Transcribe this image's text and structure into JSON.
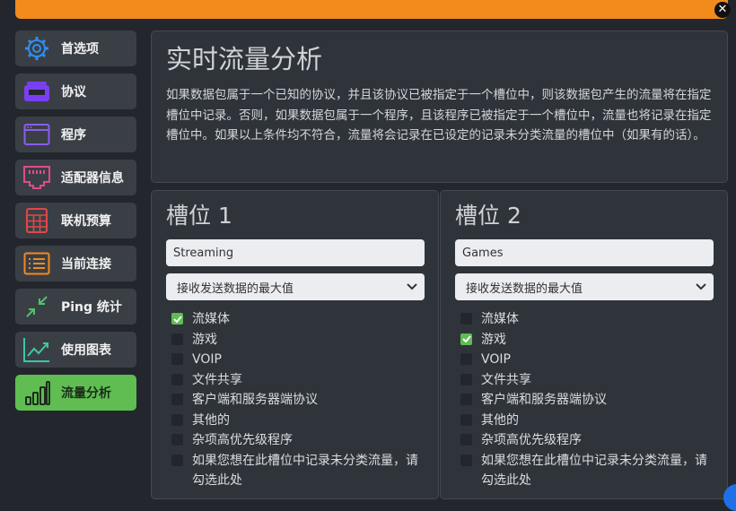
{
  "colors": {
    "topbar": "#f28a1c",
    "active": "#5fbd52",
    "panel": "#2f343b"
  },
  "sidebar": {
    "items": [
      {
        "label": "首选项",
        "icon": "gear-icon",
        "color": "#2f8ff0"
      },
      {
        "label": "协议",
        "icon": "stack-icon",
        "color": "#7b3ff2"
      },
      {
        "label": "程序",
        "icon": "window-icon",
        "color": "#8a5cf0"
      },
      {
        "label": "适配器信息",
        "icon": "ethernet-port-icon",
        "color": "#e24a8a"
      },
      {
        "label": "联机预算",
        "icon": "calculator-icon",
        "color": "#e04848"
      },
      {
        "label": "当前连接",
        "icon": "list-icon",
        "color": "#f28a1c"
      },
      {
        "label": "Ping 统计",
        "icon": "compress-arrows-icon",
        "color": "#4cc46a"
      },
      {
        "label": "使用图表",
        "icon": "trend-chart-icon",
        "color": "#3cc9a0"
      },
      {
        "label": "流量分析",
        "icon": "bar-chart-icon",
        "color": "#1d2a1b",
        "active": true
      }
    ]
  },
  "main": {
    "title": "实时流量分析",
    "description": "如果数据包属于一个已知的协议，并且该协议已被指定于一个槽位中，则该数据包产生的流量将在指定槽位中记录。否则，如果数据包属于一个程序，且该程序已被指定于一个槽位中，流量也将记录在指定槽位中。如果以上条件均不符合，流量将会记录在已设定的记录未分类流量的槽位中（如果有的话）。"
  },
  "slots": [
    {
      "title": "槽位 1",
      "name_value": "Streaming",
      "select_value": "接收发送数据的最大值",
      "checked": [
        true,
        false,
        false,
        false,
        false,
        false,
        false,
        false
      ]
    },
    {
      "title": "槽位 2",
      "name_value": "Games",
      "select_value": "接收发送数据的最大值",
      "checked": [
        false,
        true,
        false,
        false,
        false,
        false,
        false,
        false
      ]
    }
  ],
  "categories": [
    "流媒体",
    "游戏",
    "VOIP",
    "文件共享",
    "客户端和服务器端协议",
    "其他的",
    "杂项高优先级程序",
    "如果您想在此槽位中记录未分类流量，请勾选此处"
  ]
}
